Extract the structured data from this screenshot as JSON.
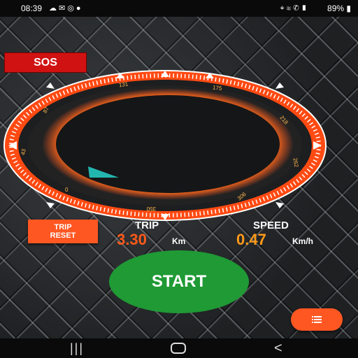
{
  "status_bar": {
    "time": "08:39",
    "battery": "89%",
    "left_icons": [
      "cloud-icon",
      "mail-icon",
      "instagram-icon",
      "app-icon"
    ],
    "right_icons": [
      "location-icon",
      "wifi-icon",
      "call-icon",
      "signal-icon",
      "battery-icon"
    ]
  },
  "sos_button": {
    "label": "SOS"
  },
  "gauge": {
    "tick_labels": [
      "0",
      "43",
      "87",
      "131",
      "175",
      "218",
      "262",
      "306",
      "350"
    ],
    "accent_color": "#ff5722"
  },
  "trip_reset_button": {
    "line1": "TRIP",
    "line2": "RESET"
  },
  "trip": {
    "title": "TRIP",
    "value": "3.30",
    "unit": "Km"
  },
  "speed": {
    "title": "SPEED",
    "value": "0.47",
    "unit": "Km/h"
  },
  "start_button": {
    "label": "START",
    "color": "#1f9a35"
  },
  "menu_fab": {
    "icon": "list-icon"
  },
  "nav_bar": {
    "recents": "|||",
    "back": "<"
  }
}
